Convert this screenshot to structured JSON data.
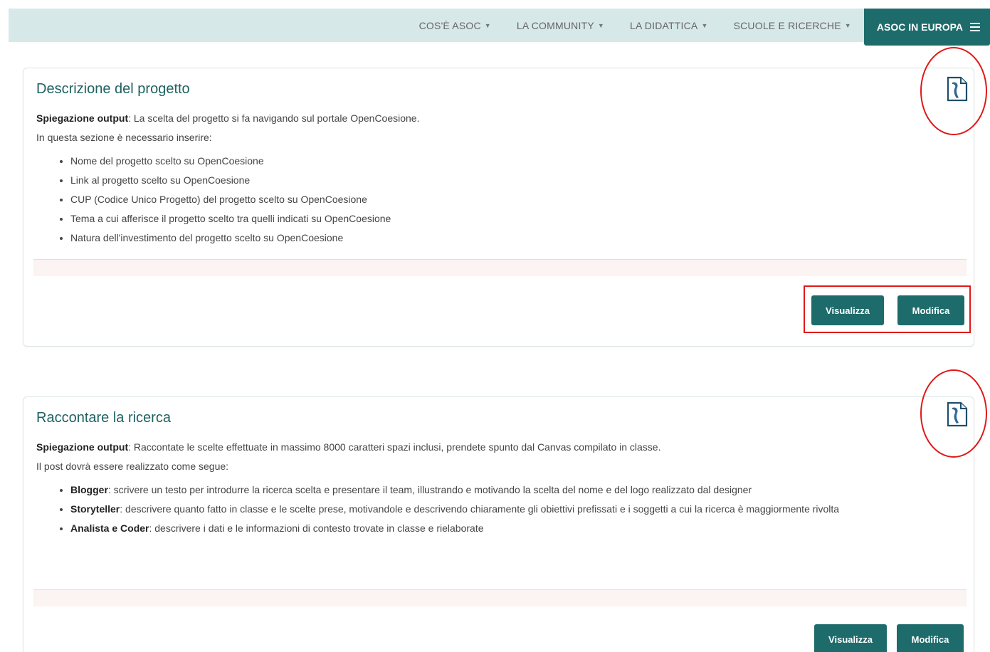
{
  "navbar": {
    "items": [
      {
        "label": "COS'È ASOC"
      },
      {
        "label": "LA COMMUNITY"
      },
      {
        "label": "LA DIDATTICA"
      },
      {
        "label": "SCUOLE E RICERCHE"
      }
    ],
    "europa_label": "ASOC IN EUROPA"
  },
  "cards": [
    {
      "title": "Descrizione del progetto",
      "intro_bold": "Spiegazione output",
      "intro_text": ": La scelta del progetto si fa navigando sul portale OpenCoesione.",
      "intro_line2": "In questa sezione è necessario inserire:",
      "items": [
        {
          "bold": "",
          "text": "Nome del progetto scelto su OpenCoesione"
        },
        {
          "bold": "",
          "text": "Link al progetto scelto su OpenCoesione"
        },
        {
          "bold": "",
          "text": "CUP (Codice Unico Progetto) del progetto scelto su OpenCoesione"
        },
        {
          "bold": "",
          "text": "Tema a cui afferisce il progetto scelto tra quelli indicati su OpenCoesione"
        },
        {
          "bold": "",
          "text": "Natura dell'investimento del progetto scelto su OpenCoesione"
        }
      ],
      "view_label": "Visualizza",
      "edit_label": "Modifica"
    },
    {
      "title": "Raccontare la ricerca",
      "intro_bold": "Spiegazione output",
      "intro_text": ": Raccontate le scelte effettuate in massimo 8000 caratteri spazi inclusi, prendete spunto dal Canvas compilato in classe.",
      "intro_line2": "Il post dovrà essere realizzato come segue:",
      "items": [
        {
          "bold": "Blogger",
          "text": ": scrivere un testo per introdurre la ricerca scelta e presentare il team, illustrando e motivando la scelta del nome e del logo realizzato dal designer"
        },
        {
          "bold": "Storyteller",
          "text": ": descrivere quanto fatto in classe e le scelte prese, motivandole e descrivendo chiaramente gli obiettivi prefissati e i soggetti a cui la ricerca è maggiormente rivolta"
        },
        {
          "bold": "Analista e Coder",
          "text": ": descrivere i dati e le informazioni di contesto trovate in classe e rielaborate"
        }
      ],
      "view_label": "Visualizza",
      "edit_label": "Modifica"
    }
  ],
  "colors": {
    "accent": "#1e6b6b",
    "navbar_bg": "#d7e8e8",
    "annotation": "#e01818"
  },
  "icons": [
    "document-icon",
    "hamburger-menu-icon",
    "caret-down-icon"
  ]
}
